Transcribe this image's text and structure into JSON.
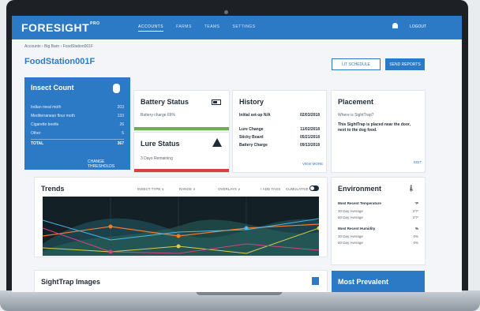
{
  "nav": {
    "logo": "FORESIGHT",
    "logo_sup": "PRO",
    "tabs": [
      "ACCOUNTS",
      "FARMS",
      "TEAMS",
      "SETTINGS"
    ],
    "logout": "LOGOUT"
  },
  "breadcrumb": "Accounts › Big Barn › FoodStation001F",
  "station_title": "FoodStation001F",
  "buttons": {
    "outline": "Lit Schedule",
    "primary": "Send Reports"
  },
  "insect_count": {
    "title": "Insect Count",
    "rows": [
      {
        "label": "Indian meal moth",
        "value": "203"
      },
      {
        "label": "Mediterranean flour moth",
        "value": "133"
      },
      {
        "label": "Cigarette beetle",
        "value": "26"
      },
      {
        "label": "Other",
        "value": "5"
      }
    ],
    "total_label": "TOTAL",
    "total_value": "367",
    "link": "CHANGE THRESHOLDS"
  },
  "battery": {
    "title": "Battery Status",
    "text": "Battery charge 69%",
    "level_percent": 69
  },
  "lure": {
    "title": "Lure Status",
    "text": "3 Days Remaining"
  },
  "history": {
    "title": "History",
    "rows": [
      {
        "label": "Initial set-up N/A",
        "date": "02/03/2018"
      },
      {
        "label": "Lure Change",
        "date": "11/02/2018"
      },
      {
        "label": "Sticky Board",
        "date": "05/21/2018"
      },
      {
        "label": "Battery Charge",
        "date": "09/13/2018"
      }
    ],
    "link": "VIEW MORE"
  },
  "placement": {
    "title": "Placement",
    "question": "Where is SightTrap?",
    "text": "This SightTrap is placed near the door, next to the dog food.",
    "edit": "EDIT"
  },
  "trends": {
    "title": "Trends",
    "controls": [
      "INSECT TYPE ∨",
      "RANGE ∨",
      "OVERLAYS ∨",
      "+ ADD TAGS",
      "CUMULATIVE"
    ]
  },
  "environment": {
    "title": "Environment",
    "temp_title": "Most Recent Temperature",
    "temp_unit": "°F",
    "temp_rows": [
      {
        "label": "30 Day Average",
        "value": "0°F"
      },
      {
        "label": "60 Day Average",
        "value": "0°F"
      }
    ],
    "hum_title": "Most Recent Humidity",
    "hum_unit": "%",
    "hum_rows": [
      {
        "label": "30 Day Average",
        "value": "0%"
      },
      {
        "label": "60 Day Average",
        "value": "0%"
      }
    ]
  },
  "sighttrap": {
    "title": "SightTrap Images"
  },
  "prevalent": {
    "title": "Most Prevalent"
  },
  "colors": {
    "accent": "#2c79c6",
    "battery": "#6ab04c",
    "lure": "#d84141",
    "plot_bg": "#132026"
  }
}
